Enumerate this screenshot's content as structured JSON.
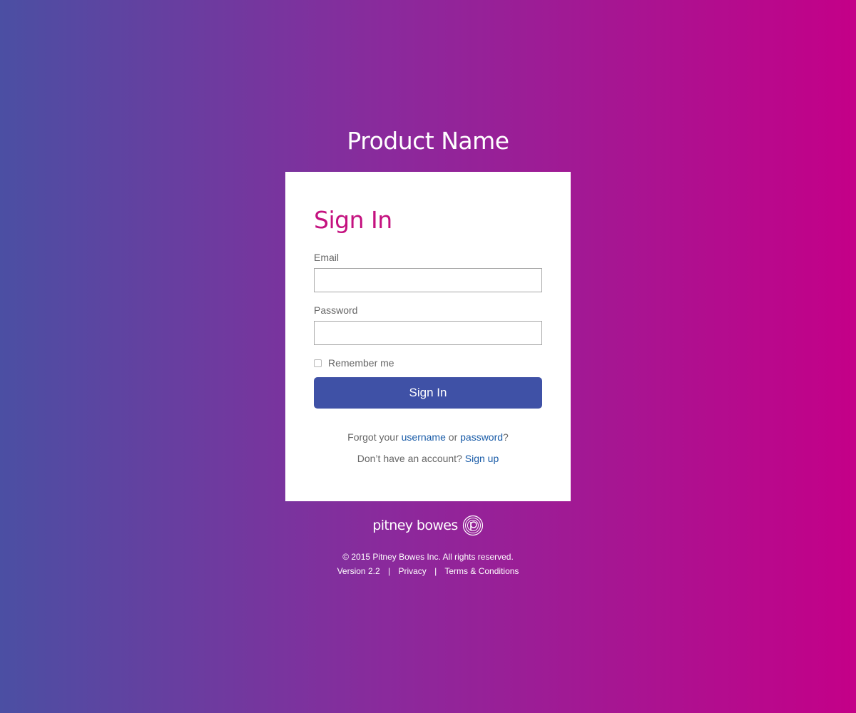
{
  "header": {
    "product_name": "Product Name"
  },
  "signin_card": {
    "title": "Sign In",
    "email_label": "Email",
    "email_value": "",
    "password_label": "Password",
    "password_value": "",
    "remember_label": "Remember me",
    "remember_checked": false,
    "submit_label": "Sign In",
    "forgot_prefix": "Forgot your",
    "forgot_username": "username",
    "forgot_or": "or",
    "forgot_password": "password",
    "forgot_suffix": "?",
    "no_account_text": "Don’t have an account?",
    "signup_link": "Sign up"
  },
  "footer": {
    "brand_text": "pitney bowes",
    "brand_icon": "pitney-bowes-logo-icon",
    "copyright": "© 2015 Pitney Bowes Inc. All rights reserved.",
    "version": "Version 2.2",
    "separator": "|",
    "privacy": "Privacy",
    "terms": "Terms & Conditions"
  },
  "colors": {
    "gradient_start": "#4b4fa3",
    "gradient_end": "#c40088",
    "title_accent": "#c4117f",
    "button_bg": "#3f51a6",
    "link": "#1a5ca8"
  }
}
